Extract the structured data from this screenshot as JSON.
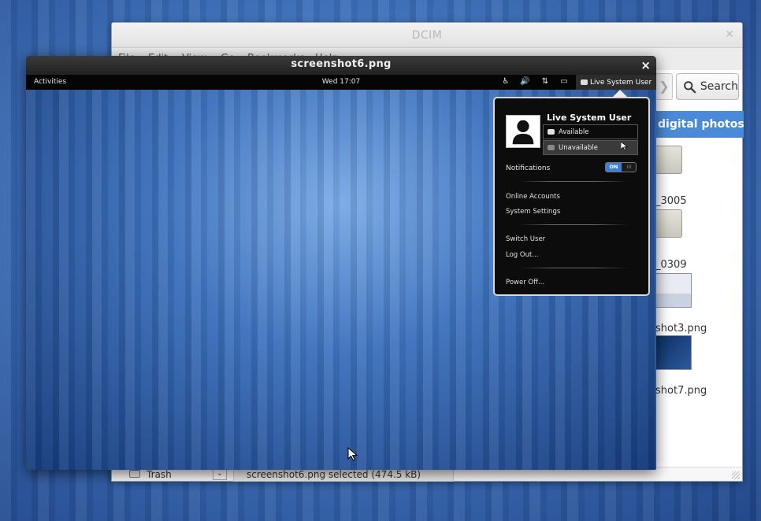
{
  "file_manager": {
    "title": "DCIM",
    "menu": [
      "File",
      "Edit",
      "View",
      "Go",
      "Bookmarks",
      "Help"
    ],
    "search_label": "Search",
    "banner_text": "digital photos.",
    "items": [
      {
        "label": "_3005",
        "kind": "folder-icon"
      },
      {
        "label": "_0309",
        "kind": "folder-icon"
      },
      {
        "label": "shot3.png",
        "kind": "image-icon"
      },
      {
        "label": "shot7.png",
        "kind": "image-icon"
      }
    ],
    "sidebar_trash": "Trash",
    "status_text": "screenshot6.png  selected (474.5 kB)"
  },
  "viewer": {
    "title": "screenshot6.png",
    "close_glyph": "×",
    "topbar": {
      "activities": "Activities",
      "clock": "Wed 17:07",
      "tray_icons": [
        "accessibility-icon",
        "volume-icon",
        "network-icon",
        "display-icon"
      ],
      "user": "Live System User"
    },
    "user_menu": {
      "name": "Live System User",
      "status_available": "Available",
      "status_unavailable": "Unavailable",
      "notifications_label": "Notifications",
      "toggle_on": "ON",
      "toggle_off": "III",
      "online_accounts": "Online Accounts",
      "system_settings": "System Settings",
      "switch_user": "Switch User",
      "log_out": "Log Out...",
      "power_off": "Power Off..."
    }
  },
  "colors": {
    "accent": "#3b7fd6",
    "banner": "#4a8ad6",
    "popup_bg": "#0c0c0c"
  }
}
